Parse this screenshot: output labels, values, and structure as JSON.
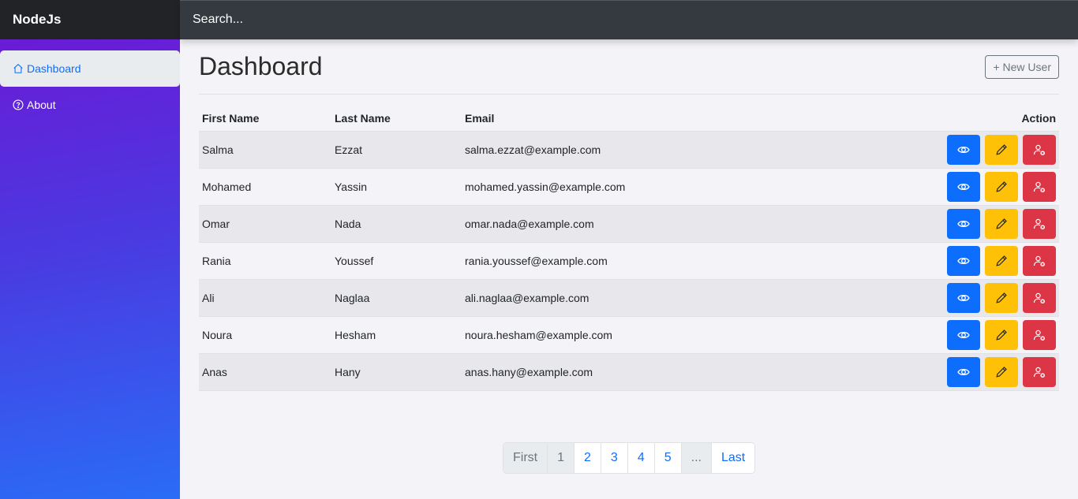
{
  "brand": "NodeJs",
  "search": {
    "placeholder": "Search..."
  },
  "sidebar": {
    "items": [
      {
        "label": "Dashboard",
        "icon": "house-icon",
        "active": true
      },
      {
        "label": "About",
        "icon": "question-circle-icon",
        "active": false
      }
    ]
  },
  "main": {
    "title": "Dashboard",
    "new_user_label": "+ New User"
  },
  "table": {
    "headers": [
      "First Name",
      "Last Name",
      "Email",
      "Action"
    ],
    "rows": [
      {
        "first": "Salma",
        "last": "Ezzat",
        "email": "salma.ezzat@example.com"
      },
      {
        "first": "Mohamed",
        "last": "Yassin",
        "email": "mohamed.yassin@example.com"
      },
      {
        "first": "Omar",
        "last": "Nada",
        "email": "omar.nada@example.com"
      },
      {
        "first": "Rania",
        "last": "Youssef",
        "email": "rania.youssef@example.com"
      },
      {
        "first": "Ali",
        "last": "Naglaa",
        "email": "ali.naglaa@example.com"
      },
      {
        "first": "Noura",
        "last": "Hesham",
        "email": "noura.hesham@example.com"
      },
      {
        "first": "Anas",
        "last": "Hany",
        "email": "anas.hany@example.com"
      }
    ]
  },
  "pagination": {
    "first": "First",
    "pages": [
      "1",
      "2",
      "3",
      "4",
      "5"
    ],
    "current": "1",
    "ellipsis": "...",
    "last": "Last"
  },
  "colors": {
    "primary": "#0d6efd",
    "warning": "#ffc107",
    "danger": "#dc3545",
    "sidebar_top": "#6a1bd6",
    "sidebar_bottom": "#2a6cf6"
  }
}
